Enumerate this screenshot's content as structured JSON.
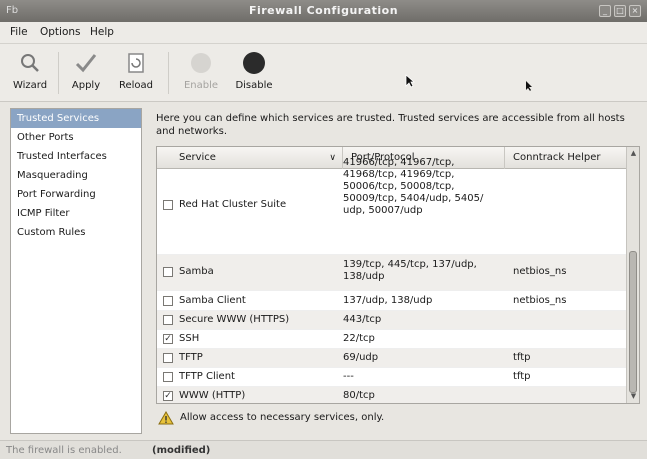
{
  "window": {
    "app_icon": "Fb",
    "title": "Firewall Configuration"
  },
  "menu": [
    {
      "label": "File"
    },
    {
      "label": "Options"
    },
    {
      "label": "Help"
    }
  ],
  "toolbar": {
    "wizard": "Wizard",
    "apply": "Apply",
    "reload": "Reload",
    "enable": "Enable",
    "disable": "Disable"
  },
  "sidebar": {
    "items": [
      {
        "label": "Trusted Services",
        "selected": true
      },
      {
        "label": "Other Ports"
      },
      {
        "label": "Trusted Interfaces"
      },
      {
        "label": "Masquerading"
      },
      {
        "label": "Port Forwarding"
      },
      {
        "label": "ICMP Filter"
      },
      {
        "label": "Custom Rules"
      }
    ]
  },
  "main": {
    "description": "Here you can define which services are trusted. Trusted services are accessible from all hosts and networks.",
    "table": {
      "columns": [
        "Service",
        "Port/Protocol",
        "Conntrack Helper"
      ],
      "rows": [
        {
          "service": "Red Hat Cluster Suite",
          "checked": false,
          "port": "41966/tcp, 41967/tcp, 41968/tcp, 41969/tcp, 50006/tcp, 50008/tcp, 50009/tcp, 5404/udp, 5405/ udp, 50007/udp",
          "helper": ""
        },
        {
          "service": "Samba",
          "checked": false,
          "port": "139/tcp, 445/tcp, 137/udp, 138/udp",
          "helper": "netbios_ns"
        },
        {
          "service": "Samba Client",
          "checked": false,
          "port": "137/udp, 138/udp",
          "helper": "netbios_ns"
        },
        {
          "service": "Secure WWW (HTTPS)",
          "checked": false,
          "port": "443/tcp",
          "helper": ""
        },
        {
          "service": "SSH",
          "checked": true,
          "port": "22/tcp",
          "helper": ""
        },
        {
          "service": "TFTP",
          "checked": false,
          "port": "69/udp",
          "helper": "tftp"
        },
        {
          "service": "TFTP Client",
          "checked": false,
          "port": "---",
          "helper": "tftp"
        },
        {
          "service": "WWW (HTTP)",
          "checked": true,
          "port": "80/tcp",
          "helper": ""
        }
      ]
    },
    "notice": "Allow access to necessary services, only."
  },
  "status": {
    "text": "The firewall is enabled.",
    "modified": "(modified)"
  },
  "colors": {
    "selection": "#8aa4c4",
    "titlebar": "#7f7d79",
    "warning": "#e8c23a"
  }
}
